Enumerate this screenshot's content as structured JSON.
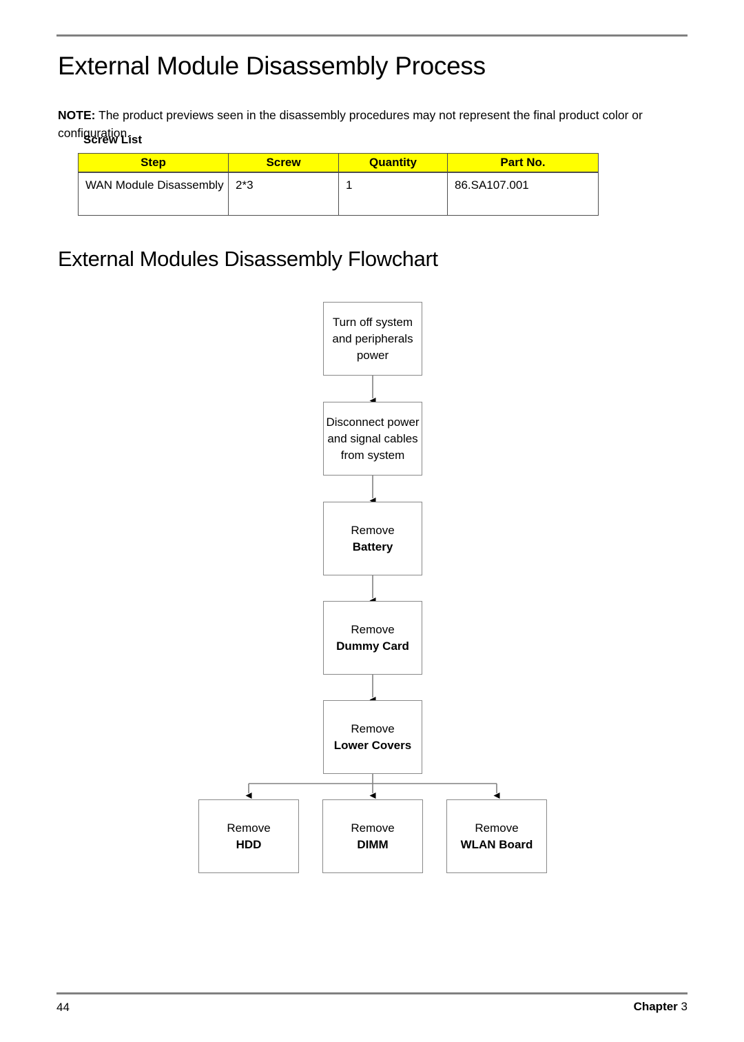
{
  "document": {
    "page_title": "External Module Disassembly Process",
    "note_label": "NOTE:",
    "note_text": " The product previews seen in the disassembly procedures may not represent the final product color or configuration.",
    "screw_list_label": "Screw List",
    "flowchart_title": "External Modules Disassembly Flowchart"
  },
  "screw_table": {
    "headers": [
      "Step",
      "Screw",
      "Quantity",
      "Part No."
    ],
    "header_bg": "#ffff00",
    "header_color": "#000000",
    "rows": [
      {
        "step": "WAN Module Disassembly",
        "screw": "2*3",
        "quantity": "1",
        "part_no": "86.SA107.001"
      }
    ]
  },
  "flowchart": {
    "nodes": [
      {
        "id": "power-off",
        "line1": "Turn off system and peripherals power",
        "line2": ""
      },
      {
        "id": "disconnect",
        "line1": "Disconnect power and signal cables from system",
        "line2": ""
      },
      {
        "id": "remove-battery",
        "line1": "Remove",
        "line2": "Battery"
      },
      {
        "id": "remove-dummy",
        "line1": "Remove",
        "line2": "Dummy Card"
      },
      {
        "id": "remove-covers",
        "line1": "Remove",
        "line2": "Lower Covers"
      },
      {
        "id": "remove-hdd",
        "line1": "Remove",
        "line2": "HDD"
      },
      {
        "id": "remove-dimm",
        "line1": "Remove",
        "line2": "DIMM"
      },
      {
        "id": "remove-wlan",
        "line1": "Remove",
        "line2": "WLAN Board"
      }
    ],
    "connector_color": "#808080",
    "arrow_color": "#000000"
  },
  "footer": {
    "page_number": "44",
    "chapter_label": "Chapter",
    "chapter_number": "3"
  }
}
